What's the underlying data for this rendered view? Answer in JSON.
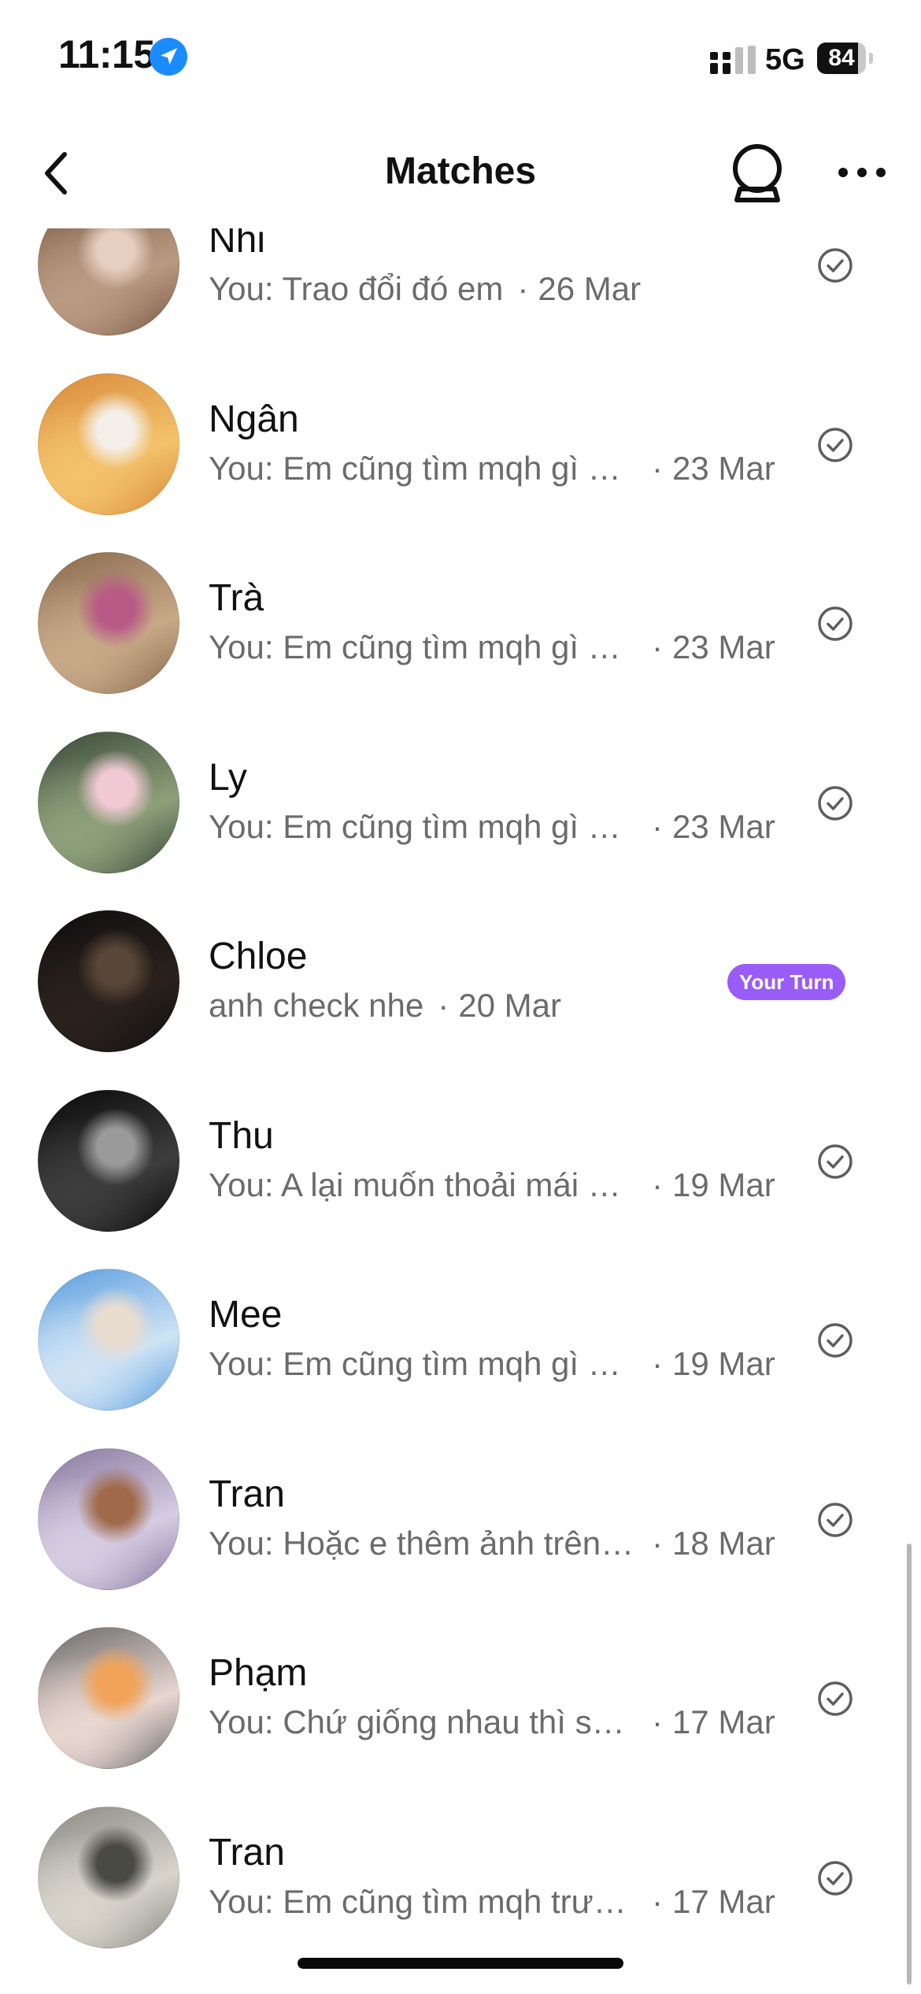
{
  "status_bar": {
    "time": "11:15",
    "network": "5G",
    "battery_level": "84",
    "battery_fraction": 0.84,
    "location_icon": "location-arrow-icon",
    "signal_icon": "cellular-signal-icon"
  },
  "nav": {
    "title": "Matches",
    "back_icon": "chevron-left-icon",
    "crystal_ball_icon": "crystal-ball-icon",
    "more_icon": "ellipsis-icon"
  },
  "colors": {
    "accent_purple": "#9a5cf6",
    "secondary_text": "#6b6b6b",
    "check_gray": "#5e5e5e"
  },
  "matches": [
    {
      "name": "Nhi",
      "preview": "You: Trao đổi đó em",
      "date": "26 Mar",
      "status": "sent",
      "truncated": false,
      "avatar_colors": [
        "#7a5a45",
        "#b99a82",
        "#e6cfc0"
      ]
    },
    {
      "name": "Ngân",
      "preview": "You: Em cũng tìm mqh gì muốn tìm người hợp",
      "date": "23 Mar",
      "status": "sent",
      "truncated": true,
      "avatar_colors": [
        "#d98a3a",
        "#f3c26b",
        "#f4efe8"
      ]
    },
    {
      "name": "Trà",
      "preview": "You: Em cũng tìm mqh gì muốn tìm người hợp",
      "date": "23 Mar",
      "status": "sent",
      "truncated": true,
      "avatar_colors": [
        "#8a6a4e",
        "#c7a988",
        "#b85a86"
      ]
    },
    {
      "name": "Ly",
      "preview": "You: Em cũng tìm mqh gì muốn tìm người hợp",
      "date": "23 Mar",
      "status": "sent",
      "truncated": true,
      "avatar_colors": [
        "#3a4a3a",
        "#8ea07a",
        "#f0c9d4"
      ]
    },
    {
      "name": "Chloe",
      "preview": "anh check nhe",
      "date": "20 Mar",
      "status": "your_turn",
      "badge": "Your Turn",
      "truncated": false,
      "avatar_colors": [
        "#0f0f0f",
        "#2a211d",
        "#5a4638"
      ]
    },
    {
      "name": "Thu",
      "preview": "You: A lại muốn thoải mái hơn",
      "date": "19 Mar",
      "status": "sent",
      "truncated": true,
      "avatar_colors": [
        "#0a0a0a",
        "#3d3d3d",
        "#9a9a9a"
      ]
    },
    {
      "name": "Mee",
      "preview": "You: Em cũng tìm mqh gì muốn tìm người hợp",
      "date": "19 Mar",
      "status": "sent",
      "truncated": true,
      "avatar_colors": [
        "#5a9ee0",
        "#cfe3f4",
        "#e9ddd0"
      ]
    },
    {
      "name": "Tran",
      "preview": "You: Hoặc e thêm ảnh trên hồ sơ nhé",
      "date": "18 Mar",
      "status": "sent",
      "truncated": true,
      "avatar_colors": [
        "#8a7aa0",
        "#d6cce2",
        "#a06a4a"
      ]
    },
    {
      "name": "Phạm",
      "preview": "You: Chứ giống nhau thì sao vui",
      "date": "17 Mar",
      "status": "sent",
      "truncated": true,
      "avatar_colors": [
        "#6a6a6a",
        "#e8d6d0",
        "#f2a35a"
      ]
    },
    {
      "name": "Tran",
      "preview": "You: Em cũng tìm mqh trước đã nhé",
      "date": "17 Mar",
      "status": "sent",
      "truncated": true,
      "avatar_colors": [
        "#8a8a84",
        "#d8d4cc",
        "#4a4a44"
      ]
    }
  ]
}
